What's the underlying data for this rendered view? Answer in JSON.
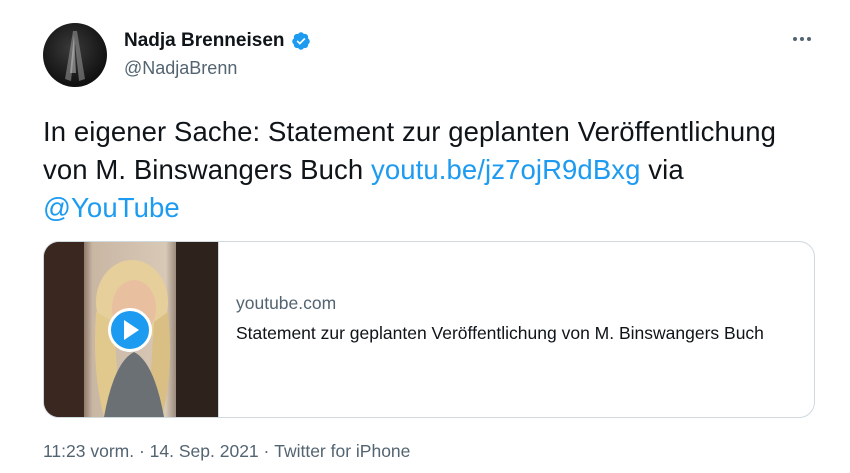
{
  "author": {
    "display_name": "Nadja Brenneisen",
    "handle": "@NadjaBrenn",
    "verified_icon": "verified-badge-icon"
  },
  "tweet": {
    "text_part1": "In eigener Sache: Statement zur geplanten Veröffentlichung von M. Binswangers Buch ",
    "link_url": "youtu.be/jz7ojR9dBxg",
    "text_part2": " via ",
    "mention": "@YouTube"
  },
  "card": {
    "domain": "youtube.com",
    "title": "Statement zur geplanten Veröffentlichung von M. Binswangers Buch",
    "play_icon": "play-icon"
  },
  "meta": {
    "time": "11:23 vorm.",
    "sep1": " · ",
    "date": "14. Sep. 2021",
    "sep2": " · ",
    "source": "Twitter for iPhone"
  },
  "colors": {
    "link": "#1d9bf0",
    "secondary_text": "#536471",
    "border": "#cfd9de"
  }
}
